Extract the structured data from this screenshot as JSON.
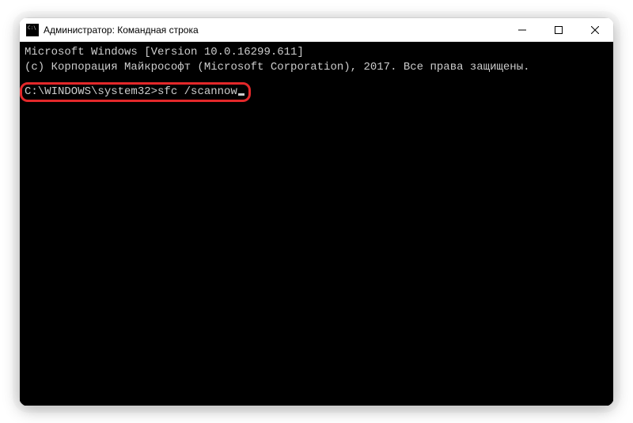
{
  "window": {
    "title": "Администратор: Командная строка"
  },
  "terminal": {
    "line1": "Microsoft Windows [Version 10.0.16299.611]",
    "line2": "(c) Корпорация Майкрософт (Microsoft Corporation), 2017. Все права защищены.",
    "prompt": "C:\\WINDOWS\\system32>",
    "command": "sfc /scannow"
  }
}
